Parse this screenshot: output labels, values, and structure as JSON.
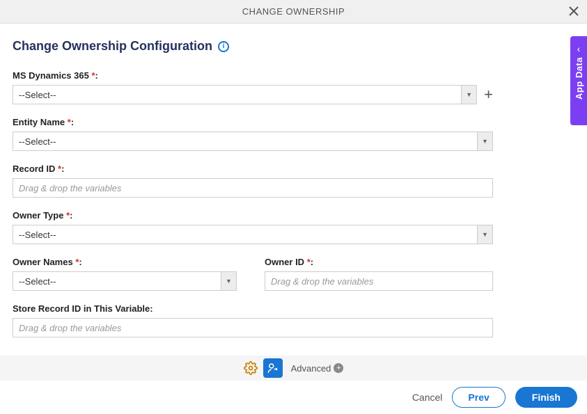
{
  "header": {
    "title": "CHANGE OWNERSHIP"
  },
  "page": {
    "title": "Change Ownership Configuration"
  },
  "sideTab": {
    "label": "App Data"
  },
  "fields": {
    "msDynamics": {
      "label": "MS Dynamics 365 ",
      "required": "*",
      "colon": ":",
      "value": "--Select--"
    },
    "entityName": {
      "label": "Entity Name ",
      "required": "*",
      "colon": ":",
      "value": "--Select--"
    },
    "recordId": {
      "label": "Record ID ",
      "required": "*",
      "colon": ":",
      "placeholder": "Drag & drop the variables"
    },
    "ownerType": {
      "label": "Owner Type ",
      "required": "*",
      "colon": ":",
      "value": "--Select--"
    },
    "ownerNames": {
      "label": "Owner Names ",
      "required": "*",
      "colon": ":",
      "value": "--Select--"
    },
    "ownerId": {
      "label": "Owner ID ",
      "required": "*",
      "colon": ":",
      "placeholder": "Drag & drop the variables"
    },
    "storeRecordId": {
      "label": "Store Record ID in This Variable:",
      "placeholder": "Drag & drop the variables"
    }
  },
  "toolbar": {
    "advanced": "Advanced"
  },
  "footer": {
    "cancel": "Cancel",
    "prev": "Prev",
    "finish": "Finish"
  }
}
